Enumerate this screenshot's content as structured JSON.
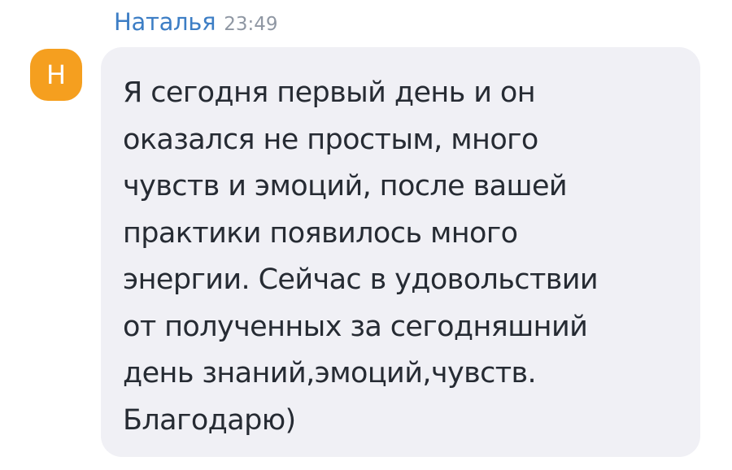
{
  "message": {
    "sender": {
      "name": "Наталья",
      "avatar_initial": "Н",
      "avatar_color": "#f59f1f"
    },
    "time": "23:49",
    "text": "Я сегодня первый день и он\nоказался не простым, много\nчувств и эмоций, после вашей\nпрактики появилось много\nэнергии. Сейчас в удовольствии\nот полученных за сегодняшний\nдень знаний,эмоций,чувств.\nБлагодарю)"
  },
  "colors": {
    "sender_name": "#3d7ec5",
    "timestamp": "#8f97a3",
    "bubble_background": "#f0f0f5",
    "text": "#262b33"
  }
}
